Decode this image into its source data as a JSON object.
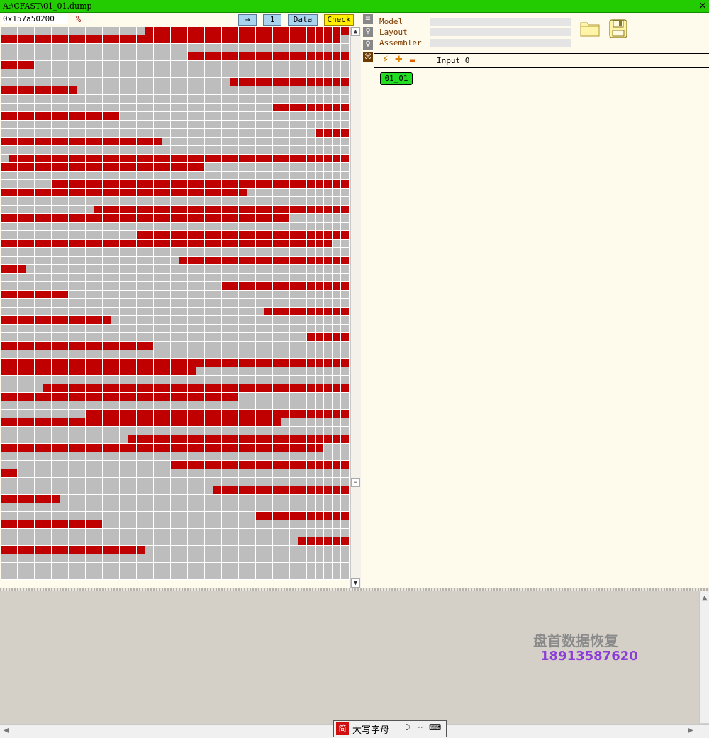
{
  "window": {
    "title": "A:\\CFAST\\01_01.dump",
    "close_label": "×"
  },
  "toolbar": {
    "address": "0x157a50200",
    "percent_label": "%",
    "arrow_label": "→",
    "count_label": "1",
    "data_label": "Data",
    "check_label": "Check"
  },
  "colors": {
    "cell_on": "#c00000",
    "cell_off": "#bdbdbd",
    "grid_line": "#ffffff",
    "title_bar": "#22cc00",
    "chip": "#22dd22"
  },
  "bitmap": {
    "cols": 41,
    "rows": 65,
    "row_fill": [
      [
        17,
        41
      ],
      [
        0,
        40
      ],
      [
        0,
        0
      ],
      [
        22,
        41
      ],
      [
        0,
        4
      ],
      [
        0,
        0
      ],
      [
        27,
        41
      ],
      [
        0,
        9
      ],
      [
        0,
        0
      ],
      [
        32,
        41
      ],
      [
        0,
        14
      ],
      [
        0,
        0
      ],
      [
        37,
        41
      ],
      [
        0,
        19
      ],
      [
        0,
        0
      ],
      [
        1,
        41
      ],
      [
        0,
        24
      ],
      [
        0,
        0
      ],
      [
        6,
        41
      ],
      [
        0,
        29
      ],
      [
        0,
        0
      ],
      [
        11,
        41
      ],
      [
        0,
        34
      ],
      [
        0,
        0
      ],
      [
        16,
        41
      ],
      [
        0,
        39
      ],
      [
        0,
        0
      ],
      [
        21,
        41
      ],
      [
        0,
        3
      ],
      [
        0,
        0
      ],
      [
        26,
        41
      ],
      [
        0,
        8
      ],
      [
        0,
        0
      ],
      [
        31,
        41
      ],
      [
        0,
        13
      ],
      [
        0,
        0
      ],
      [
        36,
        41
      ],
      [
        0,
        18
      ],
      [
        0,
        0
      ],
      [
        0,
        41
      ],
      [
        0,
        23
      ],
      [
        0,
        0
      ],
      [
        5,
        41
      ],
      [
        0,
        28
      ],
      [
        0,
        0
      ],
      [
        10,
        41
      ],
      [
        0,
        33
      ],
      [
        0,
        0
      ],
      [
        15,
        41
      ],
      [
        0,
        38
      ],
      [
        0,
        0
      ],
      [
        20,
        41
      ],
      [
        0,
        2
      ],
      [
        0,
        0
      ],
      [
        25,
        41
      ],
      [
        0,
        7
      ],
      [
        0,
        0
      ],
      [
        30,
        41
      ],
      [
        0,
        12
      ],
      [
        0,
        0
      ],
      [
        35,
        41
      ],
      [
        0,
        17
      ],
      [
        0,
        0
      ],
      [
        0,
        0
      ],
      [
        0,
        0
      ]
    ]
  },
  "scrollbar": {
    "up": "▲",
    "mid": "−",
    "down": "▼"
  },
  "side_icons": [
    "≡",
    "♀",
    "♀",
    "⌘"
  ],
  "fields": {
    "model_label": "Model",
    "layout_label": "Layout",
    "assembler_label": "Assembler"
  },
  "actions": {
    "wand": "⚡",
    "plus": "✚",
    "minus": "▬",
    "input_label": "Input 0"
  },
  "chip_label": "01_01",
  "watermark": {
    "company": "盘首数据恢复",
    "phone": "18913587620"
  },
  "ime": {
    "logo": "简",
    "mode": "大写字母",
    "moon": "☽",
    "dots": "··",
    "keyboard": "⌨"
  }
}
